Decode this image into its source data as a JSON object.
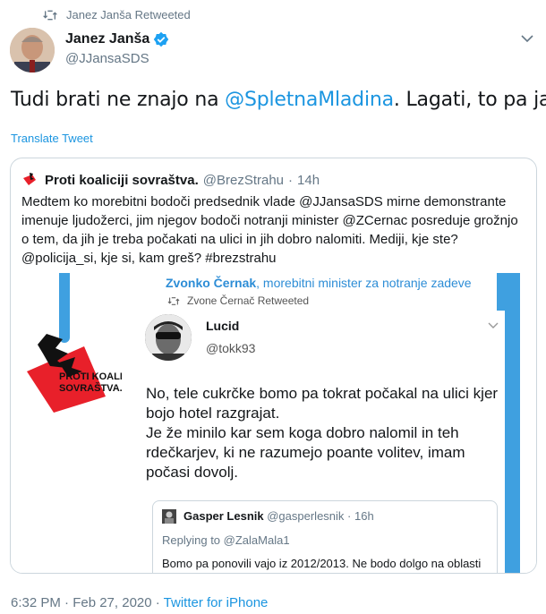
{
  "retweet": {
    "label": "Janez Janša Retweeted"
  },
  "author": {
    "name": "Janez Janša",
    "handle": "@JJansaSDS"
  },
  "tweet": {
    "text_before": "Tudi brati ne znajo na ",
    "mention": "@SpletnaMladina",
    "text_after": ". Lagati, to pa ja"
  },
  "translate_label": "Translate Tweet",
  "quote": {
    "name": "Proti koaliciji sovraštva.",
    "handle": "@BrezStrahu",
    "time": "14h",
    "separator": "·",
    "text": "Medtem ko morebitni bodoči predsednik vlade @JJansaSDS mirne demonstrante imenuje ljudožerci, jim njegov bodoči notranji minister @ZCernac posreduje grožnjo o tem, da jih je treba počakati na ulici in jih dobro nalomiti. Mediji, kje ste?@policija_si, kje si, kam greš? #brezstrahu",
    "media": {
      "header_name": "Zvonko Černak",
      "header_rest": ", morebitni minister za notranje zadeve",
      "retweet_label": "Zvone Černač Retweeted",
      "logo_line1": "PROTI KOALICIJI",
      "logo_line2": "SOVRAŠTVA.",
      "inner_tweet": {
        "name": "Lucid",
        "handle": "@tokk93",
        "text": "No, tele cukrčke bomo pa tokrat počakal na ulici kjer bojo hotel razgrajat.\nJe že minilo kar sem koga dobro nalomil in teh rdečkarjev, ki ne razumejo poante volitev, imam počasi dovolj."
      },
      "sub_tweet": {
        "name": "Gasper Lesnik",
        "handle": "@gasperlesnik",
        "time": "16h",
        "separator": "·",
        "replying": "Replying to @ZalaMala1",
        "text": "Bomo pa ponovili vajo iz 2012/2013. Ne bodo dolgo na oblasti"
      }
    }
  },
  "footer": {
    "time": "6:32 PM · Feb 27, 2020 · ",
    "source": "Twitter for iPhone"
  },
  "colors": {
    "link": "#1b95e0",
    "muted": "#657786",
    "accent_bar": "#3fa0e0",
    "logo_red": "#e8202a"
  }
}
